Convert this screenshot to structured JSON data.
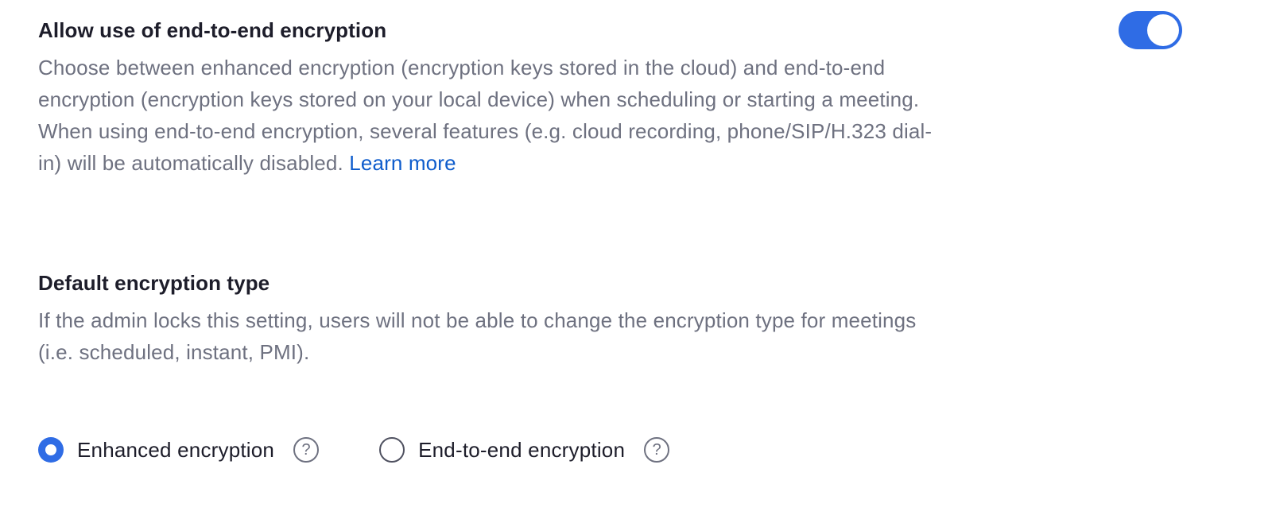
{
  "e2e_setting": {
    "title": "Allow use of end-to-end encryption",
    "description_lines": [
      "Choose between enhanced encryption (encryption keys stored in the cloud) and end-to-end",
      "encryption (encryption keys stored on your local device) when scheduling or starting a meeting.",
      "When using end-to-end encryption, several features (e.g. cloud recording, phone/SIP/H.323 dial-",
      "in) will be automatically disabled. "
    ],
    "learn_more_label": "Learn more",
    "toggle_on": true,
    "accent_color": "#2f6ce5"
  },
  "default_encryption": {
    "title": "Default encryption type",
    "description_lines": [
      "If the admin locks this setting, users will not be able to change the encryption type for meetings",
      "(i.e. scheduled, instant, PMI)."
    ],
    "options": [
      {
        "label": "Enhanced encryption",
        "selected": true,
        "help_icon": "question-circle-icon"
      },
      {
        "label": "End-to-end encryption",
        "selected": false,
        "help_icon": "question-circle-icon"
      }
    ],
    "help_glyph": "?"
  }
}
